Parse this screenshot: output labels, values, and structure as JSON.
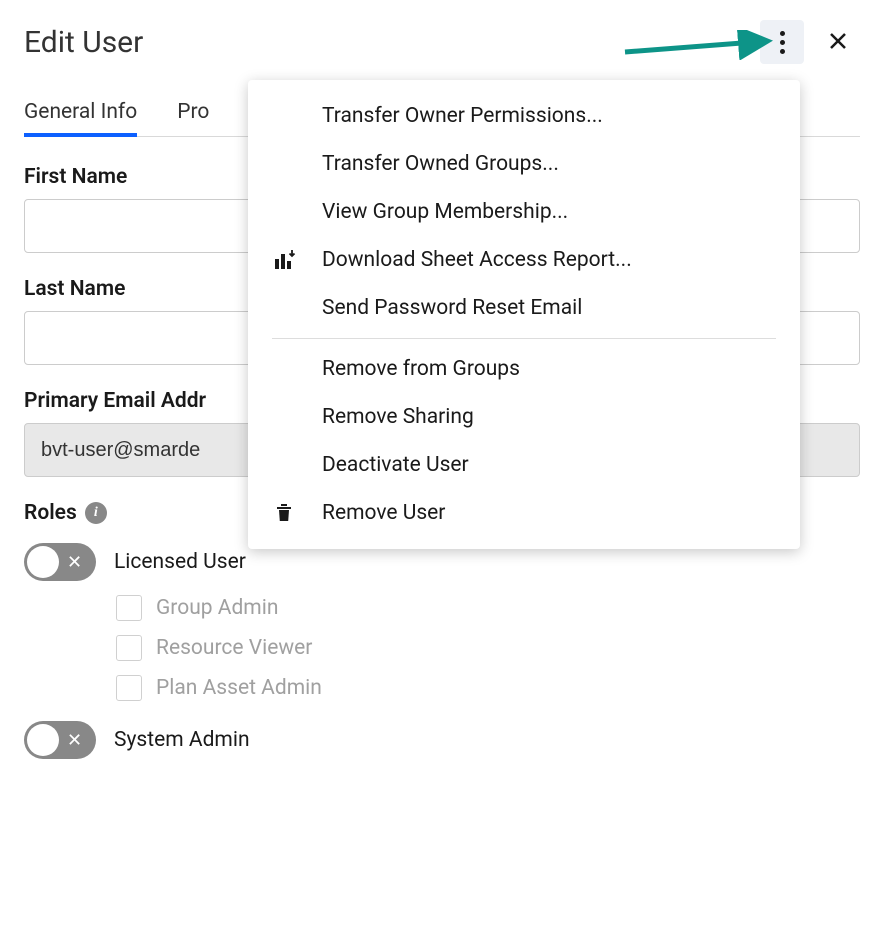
{
  "header": {
    "title": "Edit User"
  },
  "tabs": {
    "general": "General Info",
    "profile": "Pro"
  },
  "form": {
    "firstNameLabel": "First Name",
    "firstNameValue": "",
    "lastNameLabel": "Last Name",
    "lastNameValue": "",
    "emailLabel": "Primary Email Addr",
    "emailValue": "bvt-user@smarde"
  },
  "roles": {
    "header": "Roles",
    "licensedUser": "Licensed User",
    "groupAdmin": "Group Admin",
    "resourceViewer": "Resource Viewer",
    "planAssetAdmin": "Plan Asset Admin",
    "systemAdmin": "System Admin"
  },
  "menu": {
    "transferOwnerPermissions": "Transfer Owner Permissions...",
    "transferOwnedGroups": "Transfer Owned Groups...",
    "viewGroupMembership": "View Group Membership...",
    "downloadSheetAccessReport": "Download Sheet Access Report...",
    "sendPasswordResetEmail": "Send Password Reset Email",
    "removeFromGroups": "Remove from Groups",
    "removeSharing": "Remove Sharing",
    "deactivateUser": "Deactivate User",
    "removeUser": "Remove User"
  }
}
